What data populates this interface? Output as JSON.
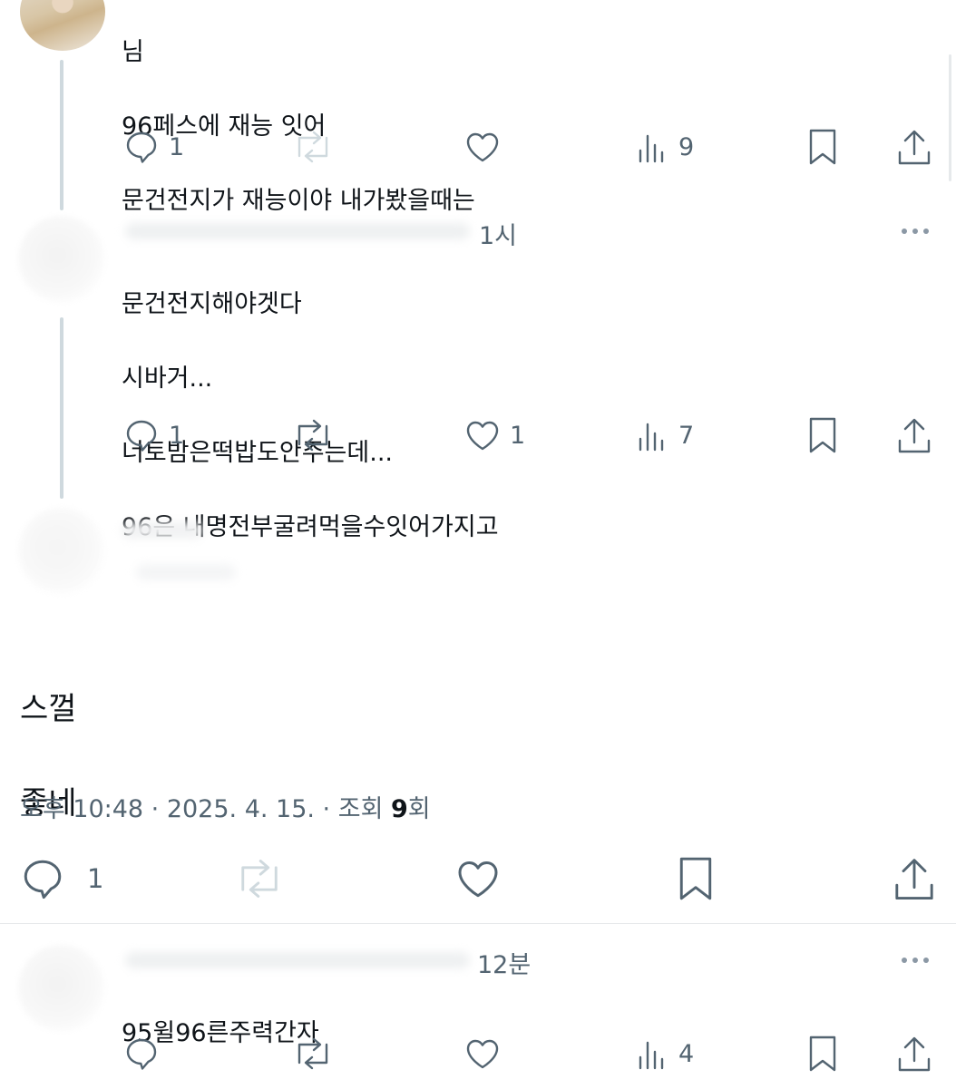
{
  "tweet1": {
    "lines": [
      "님",
      "96페스에 재능 잇어",
      "문건전지가 재능이야 내가봤을때는"
    ],
    "reply_count": "1",
    "views": "9"
  },
  "tweet2": {
    "time": "1시",
    "lines": [
      "문건전지해야겟다",
      "시바거...",
      "너토밤은떡밥도안주는데...",
      "96은 내명전부굴려먹을수잇어가지고"
    ],
    "reply_count": "1",
    "like_count": "1",
    "views": "7"
  },
  "main_tweet": {
    "lines": [
      "스껄",
      "좋네"
    ],
    "timestamp_prefix": "오후 10:48 · 2025. 4. 15. · 조회 ",
    "view_count": "9",
    "timestamp_suffix": "회",
    "reply_count": "1"
  },
  "reply": {
    "time": "12분",
    "text": "95윌96른주력간자",
    "views": "4"
  },
  "icons": [
    "reply-icon",
    "retweet-icon",
    "like-icon",
    "views-icon",
    "bookmark-icon",
    "share-icon",
    "more-icon"
  ],
  "colors": {
    "text": "#0f1419",
    "muted": "#536471",
    "thread_line": "#cfd9de"
  }
}
